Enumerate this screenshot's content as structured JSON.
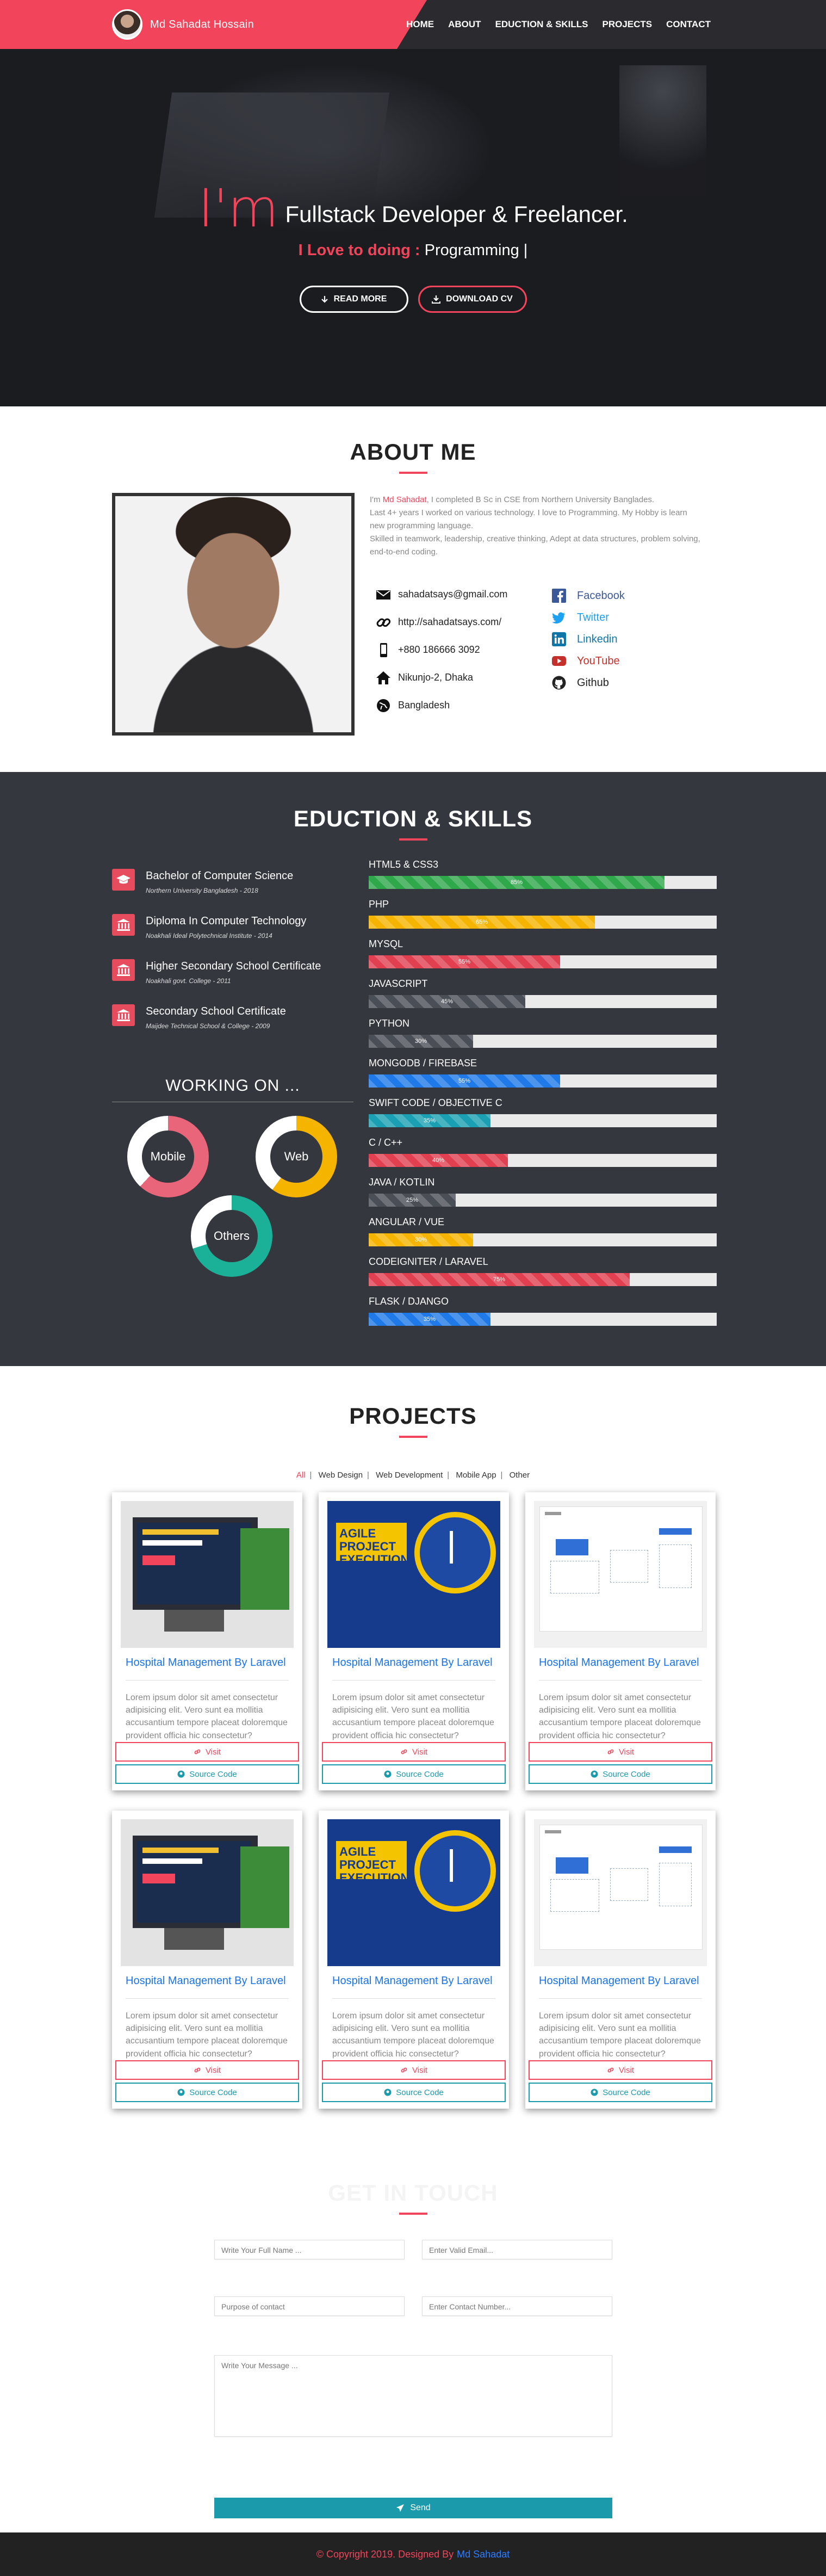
{
  "nav": {
    "brand": "Md Sahadat Hossain",
    "links": [
      "HOME",
      "ABOUT",
      "EDUCTION & SKILLS",
      "PROJECTS",
      "CONTACT"
    ]
  },
  "hero": {
    "im": "I'm",
    "role": "Fullstack Developer & Freelancer.",
    "love_label": "I Love to doing :",
    "love_value": "Programming |",
    "read_more": "READ MORE",
    "download": "DOWNLOAD CV"
  },
  "about": {
    "title": "ABOUT ME",
    "intro_prefix": "I'm",
    "intro_name": "Md Sahadat",
    "intro_rest": ", I completed B Sc in CSE from Northern University Banglades.",
    "line2": "Last 4+ years I worked on various technology. I love to Programming. My Hobby is learn new programming language.",
    "line3": "Skilled in teamwork, leadership, creative thinking, Adept at data structures, problem solving, end-to-end coding.",
    "contacts": [
      "sahadatsays@gmail.com",
      "http://sahadatsays.com/",
      "+880 186666 3092",
      "Nikunjo-2, Dhaka",
      "Bangladesh"
    ],
    "socials": [
      {
        "label": "Facebook",
        "color": "#3b5998"
      },
      {
        "label": "Twitter",
        "color": "#1da1f2"
      },
      {
        "label": "Linkedin",
        "color": "#0e76a8"
      },
      {
        "label": "YouTube",
        "color": "#c4302b"
      },
      {
        "label": "Github",
        "color": "#222222"
      }
    ]
  },
  "skills": {
    "title": "EDUCTION & SKILLS",
    "education": [
      {
        "title": "Bachelor of Computer Science",
        "place": "Northern University Bangladesh - 2018"
      },
      {
        "title": "Diploma In Computer Technology",
        "place": "Noakhali Ideal Polytechnical Institute - 2014"
      },
      {
        "title": "Higher Secondary School Certificate",
        "place": "Noakhali govt. College - 2011"
      },
      {
        "title": "Secondary School Certificate",
        "place": "Maijdee Technical School & College - 2009"
      }
    ],
    "working_title": "WORKING ON ...",
    "working": [
      {
        "label": "Mobile",
        "color": "#e8657a",
        "percent": 62
      },
      {
        "label": "Web",
        "color": "#f5b400",
        "percent": 60
      },
      {
        "label": "Others",
        "color": "#1bb198",
        "percent": 70
      }
    ],
    "bars": [
      {
        "name": "HTML5 & CSS3",
        "value": 85,
        "label": "85%",
        "color": "#2ea84a"
      },
      {
        "name": "PHP",
        "value": 65,
        "label": "65%",
        "color": "#f5b400"
      },
      {
        "name": "MYSQL",
        "value": 55,
        "label": "55%",
        "color": "#e04050"
      },
      {
        "name": "JAVASCRIPT",
        "value": 45,
        "label": "45%",
        "color": "#4a4e57"
      },
      {
        "name": "PYTHON",
        "value": 30,
        "label": "30%",
        "color": "#4a4e57"
      },
      {
        "name": "MONGODB / FIREBASE",
        "value": 55,
        "label": "55%",
        "color": "#1f7ae8"
      },
      {
        "name": "SWIFT CODE / OBJECTIVE C",
        "value": 35,
        "label": "35%",
        "color": "#1aa0b2"
      },
      {
        "name": "C / C++",
        "value": 40,
        "label": "40%",
        "color": "#e04050"
      },
      {
        "name": "JAVA / KOTLIN",
        "value": 25,
        "label": "25%",
        "color": "#4a4e57"
      },
      {
        "name": "ANGULAR / VUE",
        "value": 30,
        "label": "30%",
        "color": "#f5b400"
      },
      {
        "name": "CODEIGNITER / LARAVEL",
        "value": 75,
        "label": "75%",
        "color": "#e04050"
      },
      {
        "name": "FLASK / DJANGO",
        "value": 35,
        "label": "35%",
        "color": "#1f7ae8"
      }
    ]
  },
  "projects": {
    "title": "PROJECTS",
    "filters": [
      "All",
      "Web Design",
      "Web Development",
      "Mobile App",
      "Other"
    ],
    "cards": [
      {
        "thumb": "laravel",
        "title": "Hospital Management By Laravel",
        "desc": "Lorem ipsum dolor sit amet consectetur adipisicing elit. Vero sunt ea mollitia accusantium tempore placeat doloremque provident officia hic consectetur?",
        "visit": "Visit",
        "source": "Source Code"
      },
      {
        "thumb": "agile",
        "title": "Hospital Management By Laravel",
        "desc": "Lorem ipsum dolor sit amet consectetur adipisicing elit. Vero sunt ea mollitia accusantium tempore placeat doloremque provident officia hic consectetur?",
        "visit": "Visit",
        "source": "Source Code"
      },
      {
        "thumb": "app",
        "title": "Hospital Management By Laravel",
        "desc": "Lorem ipsum dolor sit amet consectetur adipisicing elit. Vero sunt ea mollitia accusantium tempore placeat doloremque provident officia hic consectetur?",
        "visit": "Visit",
        "source": "Source Code"
      },
      {
        "thumb": "laravel",
        "title": "Hospital Management By Laravel",
        "desc": "Lorem ipsum dolor sit amet consectetur adipisicing elit. Vero sunt ea mollitia accusantium tempore placeat doloremque provident officia hic consectetur?",
        "visit": "Visit",
        "source": "Source Code"
      },
      {
        "thumb": "agile",
        "title": "Hospital Management By Laravel",
        "desc": "Lorem ipsum dolor sit amet consectetur adipisicing elit. Vero sunt ea mollitia accusantium tempore placeat doloremque provident officia hic consectetur?",
        "visit": "Visit",
        "source": "Source Code"
      },
      {
        "thumb": "app",
        "title": "Hospital Management By Laravel",
        "desc": "Lorem ipsum dolor sit amet consectetur adipisicing elit. Vero sunt ea mollitia accusantium tempore placeat doloremque provident officia hic consectetur?",
        "visit": "Visit",
        "source": "Source Code"
      }
    ]
  },
  "contact": {
    "title": "GET IN TOUCH",
    "name_ph": "Write Your Full Name ...",
    "email_ph": "Enter Valid Email...",
    "purpose_ph": "Purpose of contact",
    "phone_ph": "Enter Contact Number...",
    "message_ph": "Write Your Message ...",
    "send": "Send"
  },
  "footer": {
    "copy": "© Copyright 2019. Designed By",
    "name": "Md Sahadat"
  }
}
